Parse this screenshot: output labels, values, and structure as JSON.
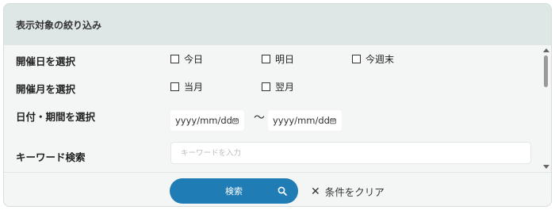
{
  "header": {
    "title": "表示対象の絞り込み"
  },
  "filters": {
    "day": {
      "label": "開催日を選択",
      "options": [
        "今日",
        "明日",
        "今週末"
      ]
    },
    "month": {
      "label": "開催月を選択",
      "options": [
        "当月",
        "翌月"
      ]
    },
    "period": {
      "label": "日付・期間を選択",
      "from_placeholder": "yyyy/mm/dd",
      "to_placeholder": "yyyy/mm/dd",
      "separator": "〜"
    },
    "keyword": {
      "label": "キーワード検索",
      "placeholder": "キーワードを入力",
      "value": ""
    }
  },
  "footer": {
    "search_label": "検索",
    "clear_label": "条件をクリア",
    "clear_glyph": "✕"
  },
  "colors": {
    "accent": "#1f7cb5",
    "header_bg": "#dfe6e6",
    "panel_bg": "#f4f6f6"
  },
  "icons": [
    "calendar-icon",
    "search-icon",
    "close-icon"
  ]
}
